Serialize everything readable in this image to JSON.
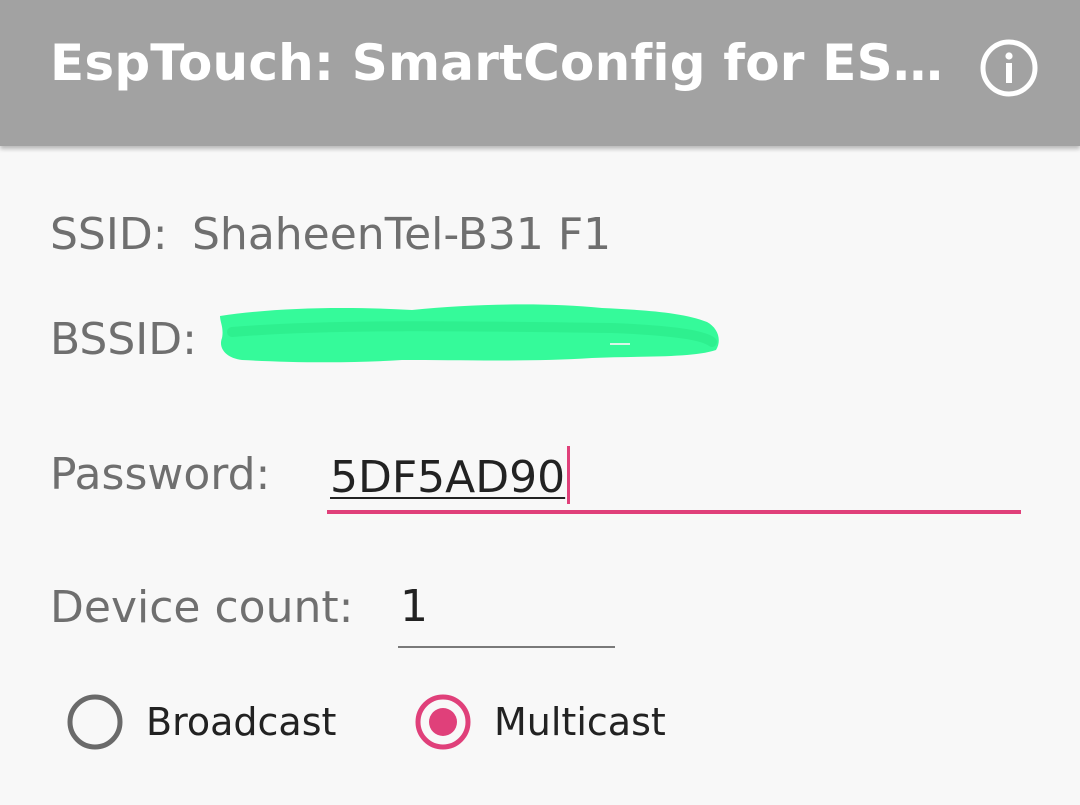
{
  "appbar": {
    "title": "EspTouch: SmartConfig for ES…",
    "info_icon": "info-circle-icon"
  },
  "form": {
    "ssid_label": "SSID:",
    "ssid_value": "ShaheenTel-B31 F1",
    "bssid_label": "BSSID:",
    "password_label": "Password:",
    "password_value": "5DF5AD90",
    "device_count_label": "Device count:",
    "device_count_value": "1",
    "broadcast_label": "Broadcast",
    "multicast_label": "Multicast",
    "selected_mode": "Multicast"
  },
  "colors": {
    "appbar_bg": "#a2a2a2",
    "accent": "#e0407a",
    "redaction": "#35fa9a"
  }
}
